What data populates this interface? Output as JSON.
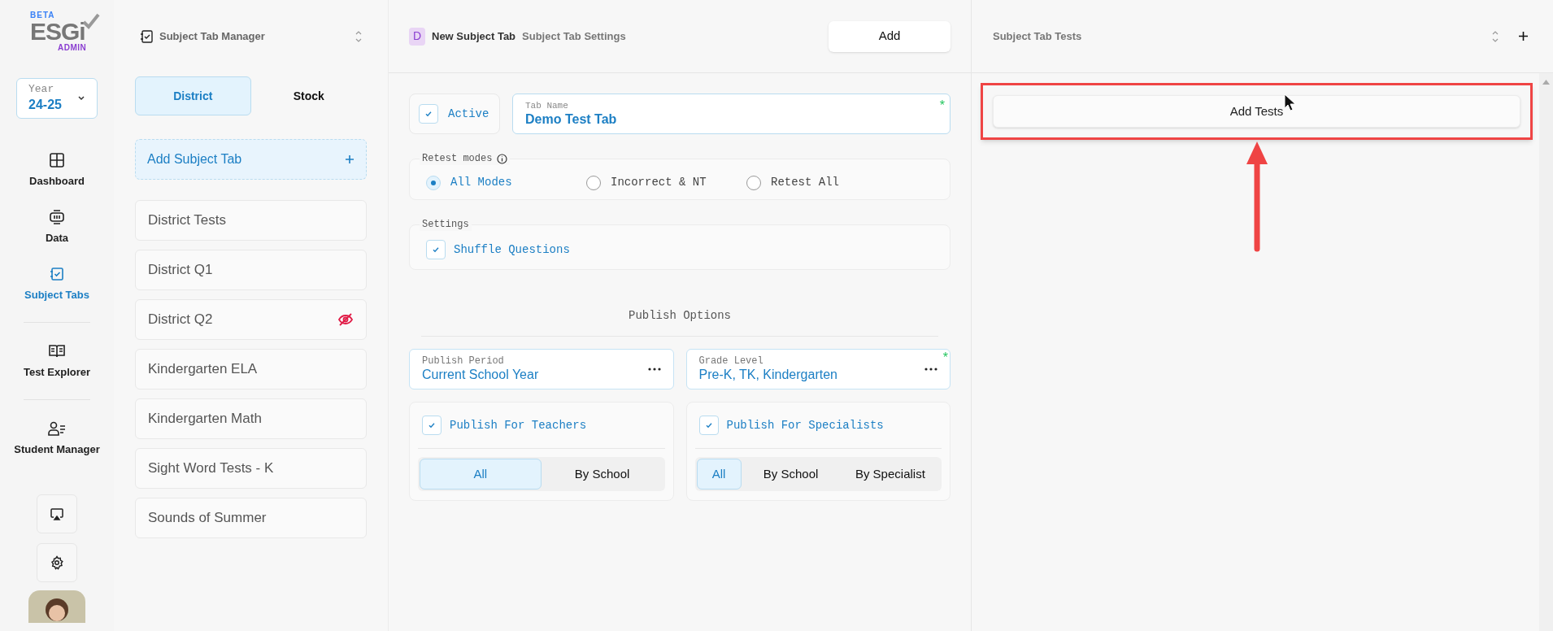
{
  "logo": {
    "badge": "BETA",
    "name": "ESGi",
    "sub": "ADMIN"
  },
  "year": {
    "label": "Year",
    "value": "24-25"
  },
  "nav_groups": [
    [
      {
        "label": "Dashboard",
        "selected": false
      },
      {
        "label": "Data",
        "selected": false
      },
      {
        "label": "Subject Tabs",
        "selected": true
      }
    ],
    [
      {
        "label": "Test Explorer",
        "selected": false
      }
    ],
    [
      {
        "label": "Student Manager",
        "selected": false
      }
    ]
  ],
  "manager": {
    "title": "Subject Tab Manager",
    "tabs": [
      {
        "label": "District",
        "selected": true
      },
      {
        "label": "Stock",
        "selected": false
      }
    ],
    "add_label": "Add Subject Tab",
    "items": [
      {
        "label": "District Tests",
        "hidden": false
      },
      {
        "label": "District Q1",
        "hidden": false
      },
      {
        "label": "District Q2",
        "hidden": true
      },
      {
        "label": "Kindergarten ELA",
        "hidden": false
      },
      {
        "label": "Kindergarten Math",
        "hidden": false
      },
      {
        "label": "Sight Word Tests - K",
        "hidden": false
      },
      {
        "label": "Sounds of Summer",
        "hidden": false
      }
    ]
  },
  "settings": {
    "badge": "D",
    "title": "New Subject Tab",
    "subtitle": "Subject Tab Settings",
    "add_button": "Add",
    "active": {
      "label": "Active",
      "checked": true
    },
    "tab_name": {
      "label": "Tab Name",
      "value": "Demo Test Tab",
      "required_mark": "*"
    },
    "retest": {
      "legend": "Retest modes",
      "options": [
        {
          "label": "All Modes",
          "selected": true
        },
        {
          "label": "Incorrect & NT",
          "selected": false
        },
        {
          "label": "Retest All",
          "selected": false
        }
      ]
    },
    "options_group": {
      "legend": "Settings",
      "options": [
        {
          "label": "Shuffle Questions",
          "checked": true
        }
      ]
    },
    "publish_heading": "Publish Options",
    "selects": [
      {
        "label": "Publish Period",
        "value": "Current School Year"
      },
      {
        "label": "Grade Level",
        "value": "Pre-K, TK, Kindergarten",
        "required_mark": "*"
      }
    ],
    "audiences": [
      {
        "label": "Publish For Teachers",
        "checked": true,
        "options": [
          {
            "label": "All",
            "selected": true
          },
          {
            "label": "By School",
            "selected": false
          }
        ]
      },
      {
        "label": "Publish For Specialists",
        "checked": true,
        "options": [
          {
            "label": "All",
            "selected": true
          },
          {
            "label": "By School",
            "selected": false
          },
          {
            "label": "By Specialist",
            "selected": false
          }
        ]
      }
    ]
  },
  "tests": {
    "title": "Subject Tab Tests",
    "add_button": "Add Tests",
    "highlighted": true
  }
}
